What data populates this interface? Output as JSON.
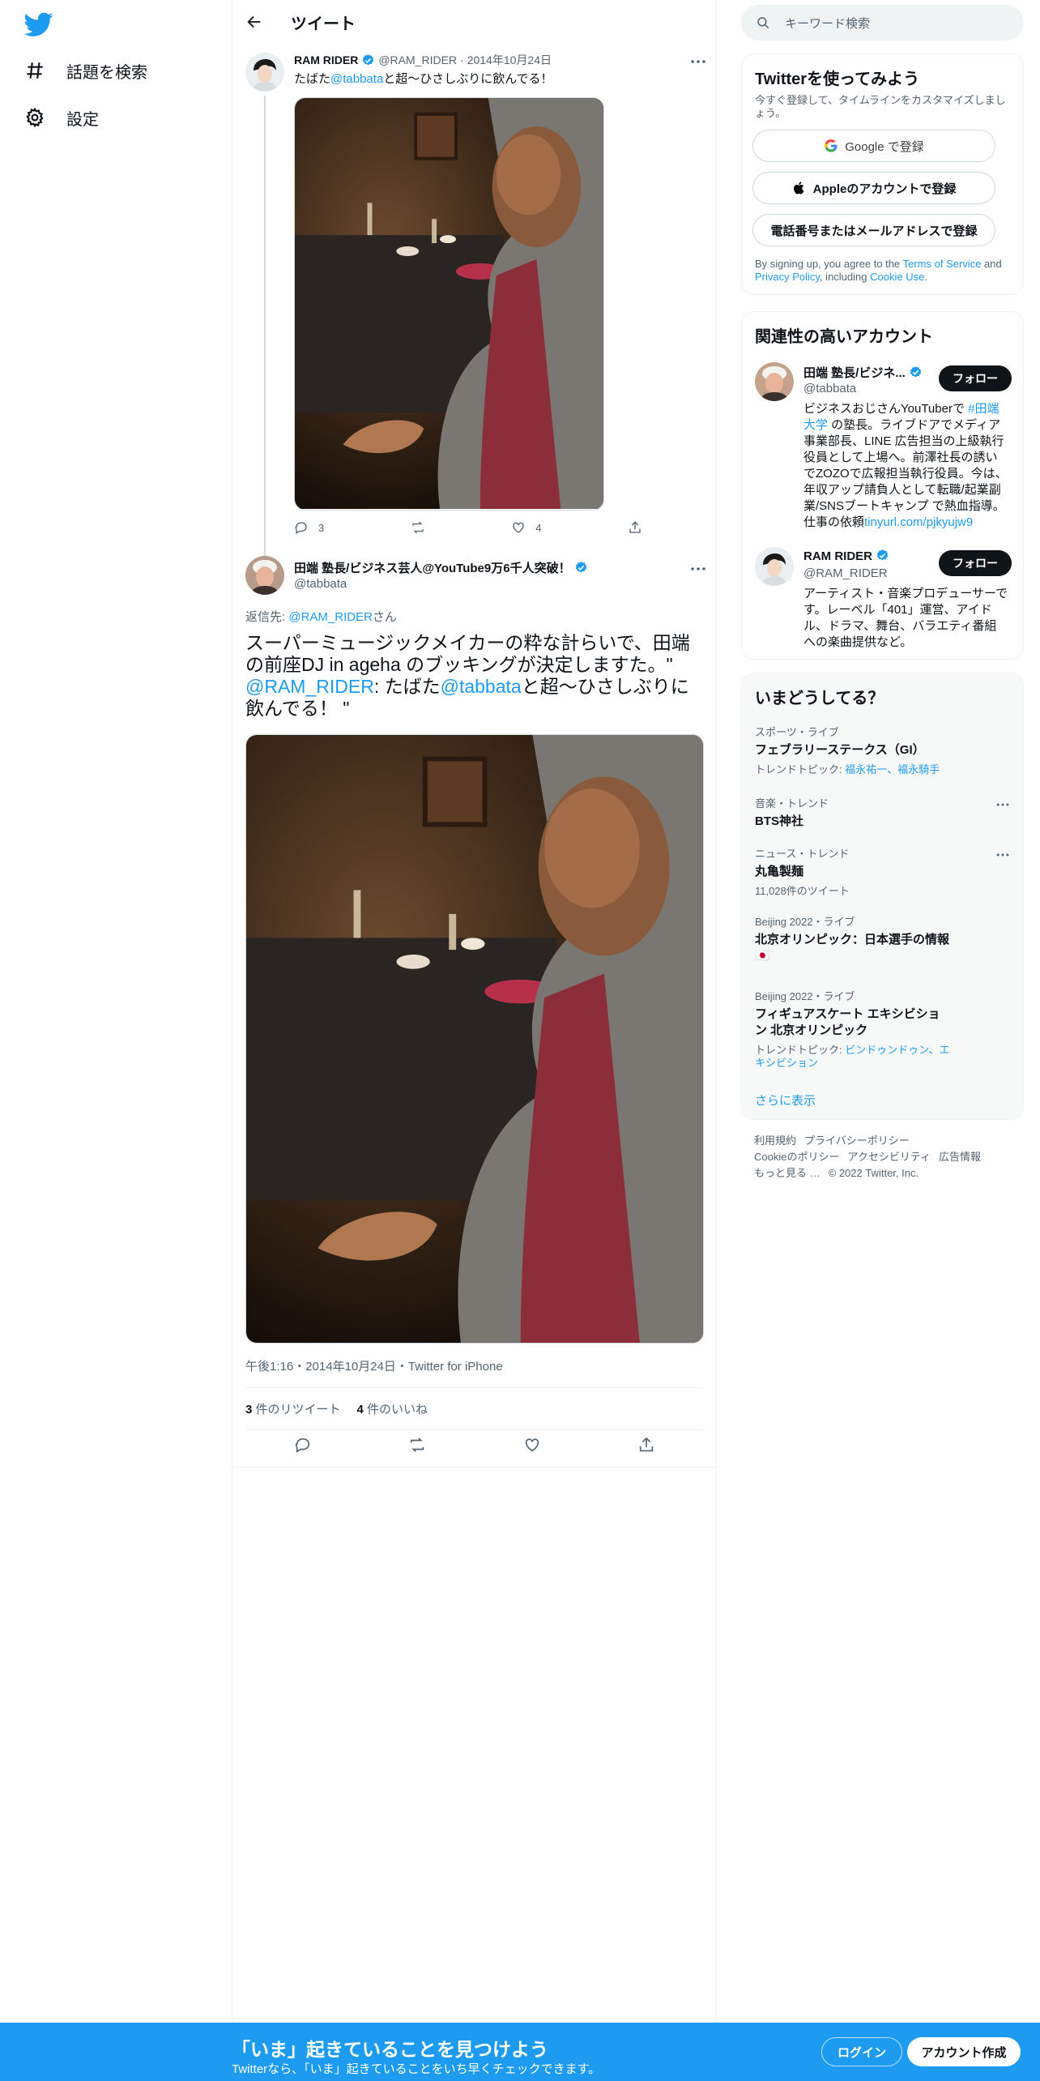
{
  "nav": {
    "items": [
      {
        "icon": "hashtag-icon",
        "label": "話題を検索"
      },
      {
        "icon": "gear-icon",
        "label": "設定"
      }
    ]
  },
  "header": {
    "title": "ツイート"
  },
  "parent_tweet": {
    "name": "RAM RIDER",
    "handle": "@RAM_RIDER",
    "date": "2014年10月24日",
    "text_before": "たばた",
    "mention": "@tabbata",
    "text_after": "と超〜ひさしぶりに飲んでる！",
    "replies": "3",
    "likes": "4"
  },
  "main_tweet": {
    "name": "田端 塾長/ビジネス芸人@YouTube9万6千人突破！",
    "handle": "@tabbata",
    "reply_prefix": "返信先: ",
    "reply_mention": "@RAM_RIDER",
    "reply_suffix": "さん",
    "text_part1": "スーパーミュージックメイカーの粋な計らいで、田端の前座DJ in ageha のブッキングが決定しますた。\"",
    "text_mention1": "@RAM_RIDER",
    "text_part2": ": たばた",
    "text_mention2": "@tabbata",
    "text_part3": "と超〜ひさしぶりに飲んでる！ \"",
    "meta": "午後1:16・2014年10月24日・Twitter for iPhone",
    "retweet_count": "3",
    "retweet_label": "件のリツイート",
    "like_count": "4",
    "like_label": "件のいいね"
  },
  "search": {
    "placeholder": "キーワード検索"
  },
  "signup_card": {
    "title": "Twitterを使ってみよう",
    "subtitle": "今すぐ登録して、タイムラインをカスタマイズしましょう。",
    "google": "Google で登録",
    "apple": "Appleのアカウントで登録",
    "phone": "電話番号またはメールアドレスで登録",
    "terms_1": "By signing up, you agree to the ",
    "terms_tos": "Terms of Service",
    "terms_2": " and ",
    "terms_pp": "Privacy Policy",
    "terms_3": ", including ",
    "terms_cookie": "Cookie Use",
    "terms_4": "."
  },
  "related": {
    "title": "関連性の高いアカウント",
    "accounts": [
      {
        "name": "田端 塾長/ビジネ...",
        "handle": "@tabbata",
        "follow": "フォロー",
        "bio_1": "ビジネスおじさんYouTuberで ",
        "bio_tag": "#田端大学",
        "bio_2": " の塾長。ライブドアでメディア事業部長、LINE 広告担当の上級執行役員として上場へ。前澤社長の誘いでZOZOで広報担当執行役員。今は、年収アップ請負人として転職/起業副業/SNSブートキャンプ で熱血指導。仕事の依頼",
        "bio_link": "tinyurl.com/pjkyujw9"
      },
      {
        "name": "RAM RIDER",
        "handle": "@RAM_RIDER",
        "follow": "フォロー",
        "bio": "アーティスト・音楽プロデューサーです。レーベル「401」運営、アイドル、ドラマ、舞台、バラエティ番組への楽曲提供など。"
      }
    ]
  },
  "trends": {
    "title": "いまどうしてる？",
    "items": [
      {
        "meta": "スポーツ・ライブ",
        "name": "フェブラリーステークス（GI）",
        "sub_prefix": "トレンドトピック: ",
        "sub_links": "福永祐一、福永騎手"
      },
      {
        "meta": "音楽・トレンド",
        "name": "BTS神社"
      },
      {
        "meta": "ニュース・トレンド",
        "name": "丸亀製麺",
        "sub": "11,028件のツイート"
      },
      {
        "meta": "Beijing 2022・ライブ",
        "name": "北京オリンピック：日本選手の情報 🇯🇵"
      },
      {
        "meta": "Beijing 2022・ライブ",
        "name": "フィギュアスケート エキシビション 北京オリンピック",
        "sub_prefix": "トレンドトピック: ",
        "sub_links": "ビンドゥンドゥン、エキシビション"
      }
    ],
    "show_more": "さらに表示"
  },
  "footer": {
    "terms": "利用規約",
    "privacy": "プライバシーポリシー",
    "cookie": "Cookieのポリシー",
    "accessibility": "アクセシビリティ",
    "ads": "広告情報",
    "more": "もっと見る …",
    "copyright": "© 2022 Twitter, Inc."
  },
  "bottom_bar": {
    "title": "「いま」起きていることを見つけよう",
    "subtitle": "Twitterなら、「いま」起きていることをいち早くチェックできます。",
    "login": "ログイン",
    "signup": "アカウント作成"
  },
  "colors": {
    "accent": "#1d9bf0",
    "text": "#0f1419",
    "muted": "#536471",
    "border": "#eff3f4"
  }
}
